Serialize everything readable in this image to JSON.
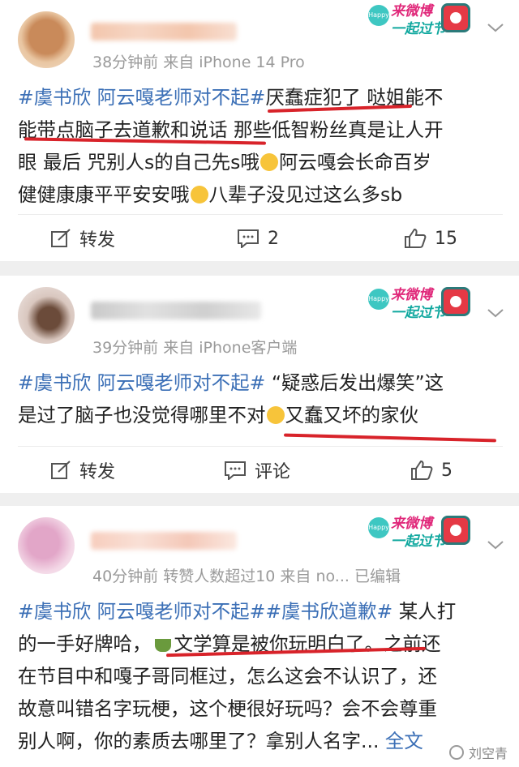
{
  "posts": [
    {
      "meta": "38分钟前  来自 iPhone 14 Pro",
      "lines": [
        [
          "#虞书欣 阿云嘎老师对不起#",
          "厌蠢症犯了 哒姐能不"
        ],
        [
          "能带点脑子去道歉和说话 那些低智粉丝真是让人开"
        ],
        [
          "眼 最后 咒别人s的自己先s哦",
          "阿云嘎会长命百岁"
        ],
        [
          "健健康康平平安安哦",
          "八辈子没见过这么多sb"
        ]
      ],
      "actions": {
        "repost": "转发",
        "comment": "2",
        "like": "15"
      }
    },
    {
      "meta": "39分钟前  来自 iPhone客户端",
      "lines": [
        [
          "#虞书欣 阿云嘎老师对不起#",
          " “疑惑后发出爆笑”这"
        ],
        [
          "是过了脑子也没觉得哪里不对",
          "又蠢又坏的家伙"
        ]
      ],
      "actions": {
        "repost": "转发",
        "comment": "评论",
        "like": "5"
      }
    },
    {
      "meta": "40分钟前  转赞人数超过10  来自 no...  已编辑",
      "lines": [
        [
          "#虞书欣 阿云嘎老师对不起##虞书欣道歉#",
          " 某人打"
        ],
        [
          "的一手好牌哈，",
          "文学算是被你玩明白了。之前还"
        ],
        [
          "在节目中和嘎子哥同框过，怎么这会不认识了，还"
        ],
        [
          "故意叫错名字玩梗，这个梗很好玩吗？会不会尊重"
        ],
        [
          "别人啊，你的素质去哪里了？拿别人名字...",
          "全文"
        ]
      ]
    }
  ],
  "badge": {
    "line1": "来微博",
    "line2": "一起过节",
    "happy": "Happy"
  },
  "watermark": "刘空青",
  "colors": {
    "link": "#3b6fb6",
    "underline": "#d8232a",
    "meta": "#9a9a9a"
  }
}
